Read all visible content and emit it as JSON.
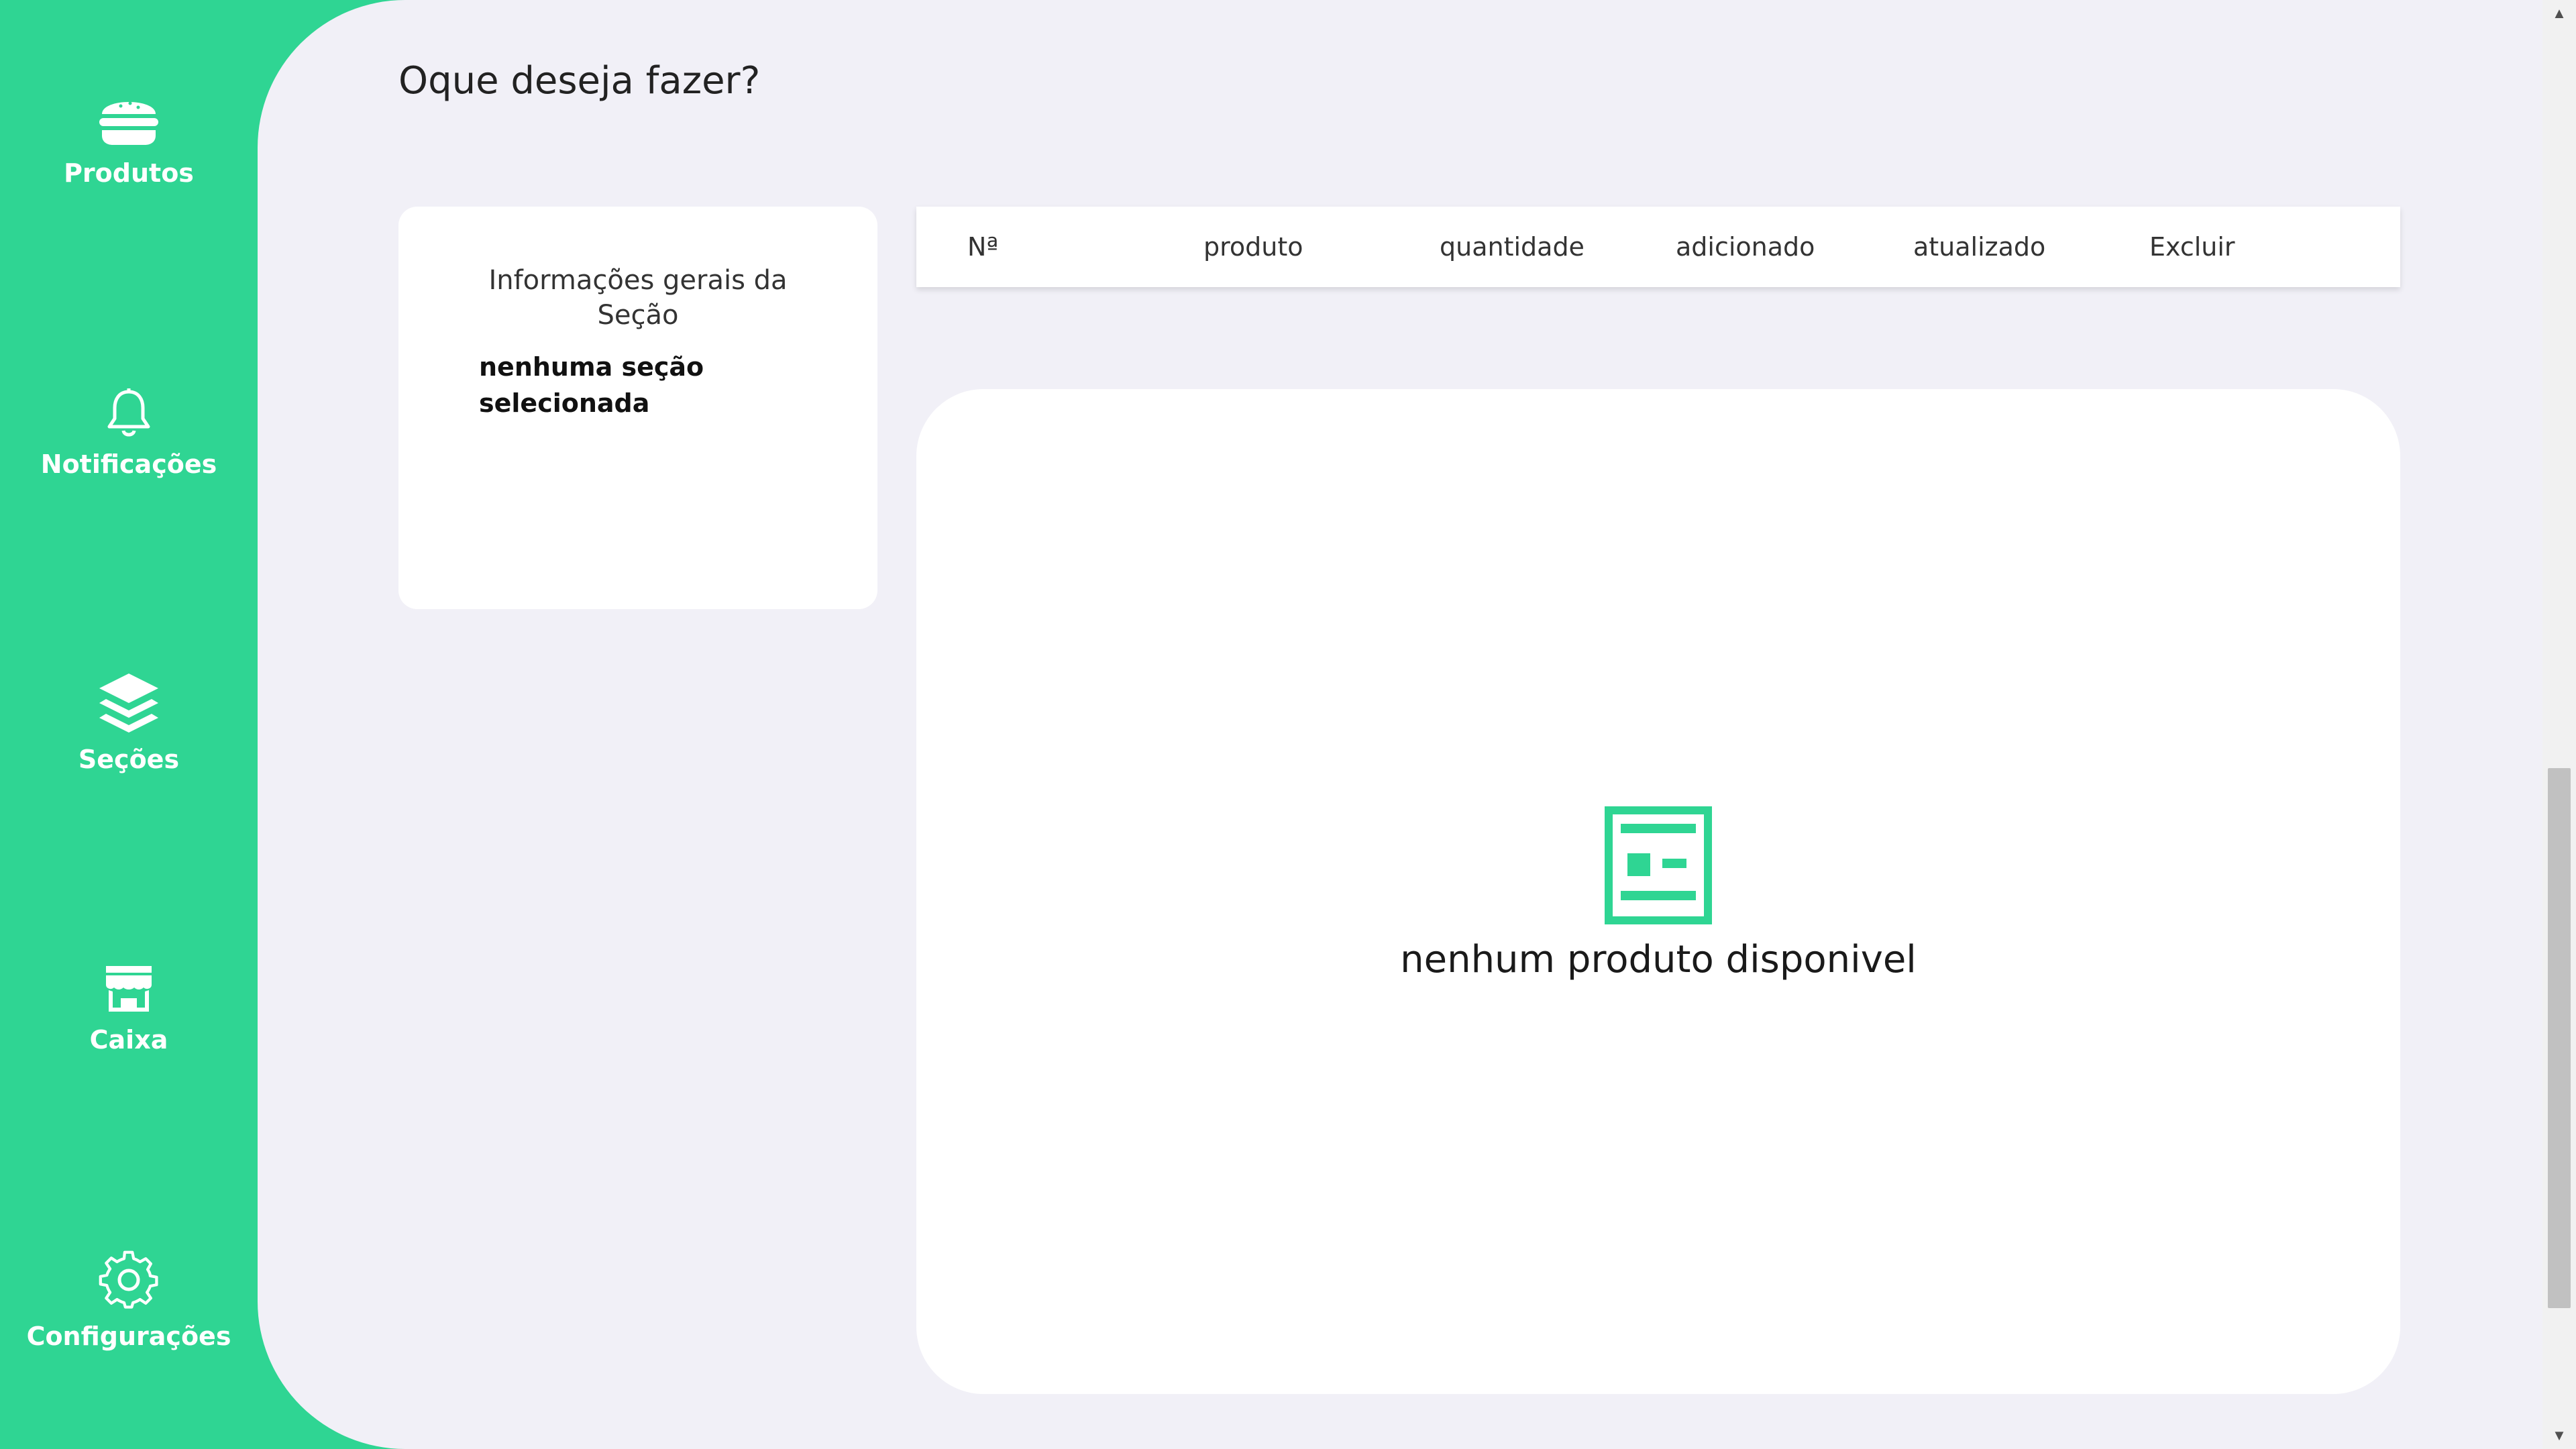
{
  "sidebar": {
    "items": [
      {
        "label": "Produtos",
        "icon": "burger-icon"
      },
      {
        "label": "Notificações",
        "icon": "bell-icon"
      },
      {
        "label": "Seções",
        "icon": "layers-icon"
      },
      {
        "label": "Caixa",
        "icon": "store-icon"
      },
      {
        "label": "Configurações",
        "icon": "gear-icon"
      }
    ]
  },
  "main": {
    "title": "Oque deseja fazer?",
    "info_card": {
      "title": "Informações gerais da Seção",
      "value": "nenhuma seção selecionada"
    },
    "table": {
      "columns": [
        "Nª",
        "produto",
        "quantidade",
        "adicionado",
        "atualizado",
        "Excluir"
      ]
    },
    "empty_state": {
      "icon": "article-icon",
      "text": "nenhum produto disponivel"
    }
  },
  "colors": {
    "accent": "#2fd593",
    "background": "#f1f0f7",
    "card": "#ffffff"
  }
}
